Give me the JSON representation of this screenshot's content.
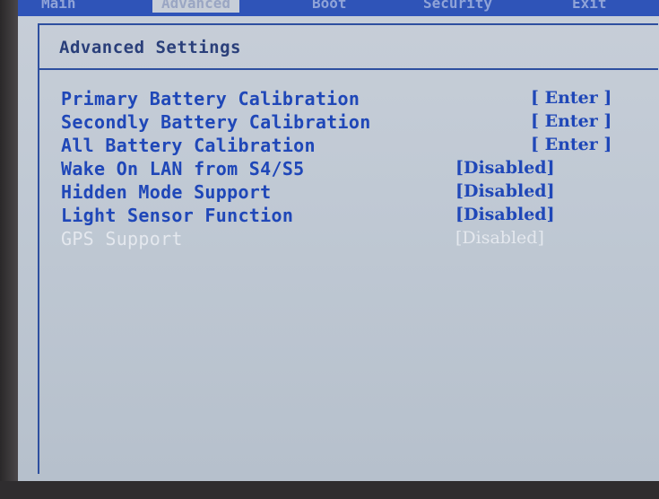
{
  "menubar": {
    "tabs": [
      {
        "label": "Main"
      },
      {
        "label": "Advanced"
      },
      {
        "label": "Boot"
      },
      {
        "label": "Security"
      },
      {
        "label": "Exit"
      }
    ],
    "active_tab": "Advanced"
  },
  "panel": {
    "title": "Advanced Settings",
    "items": [
      {
        "label": "Primary Battery Calibration",
        "value": "[ Enter ]",
        "enabled": true
      },
      {
        "label": "Secondly Battery Calibration",
        "value": "[ Enter ]",
        "enabled": true
      },
      {
        "label": "All Battery Calibration",
        "value": "[ Enter ]",
        "enabled": true
      },
      {
        "label": "Wake On LAN from S4/S5",
        "value": "[Disabled]",
        "enabled": true
      },
      {
        "label": "Hidden Mode Support",
        "value": "[Disabled]",
        "enabled": true
      },
      {
        "label": "Light Sensor Function",
        "value": "[Disabled]",
        "enabled": true
      },
      {
        "label": "GPS Support",
        "value": "[Disabled]",
        "enabled": false
      }
    ]
  },
  "colors": {
    "bios_blue": "#1f47b8",
    "menubar_blue": "#2f54b8",
    "screen_bg": "#c7ced8",
    "disabled_text": "#e4e8ee"
  }
}
